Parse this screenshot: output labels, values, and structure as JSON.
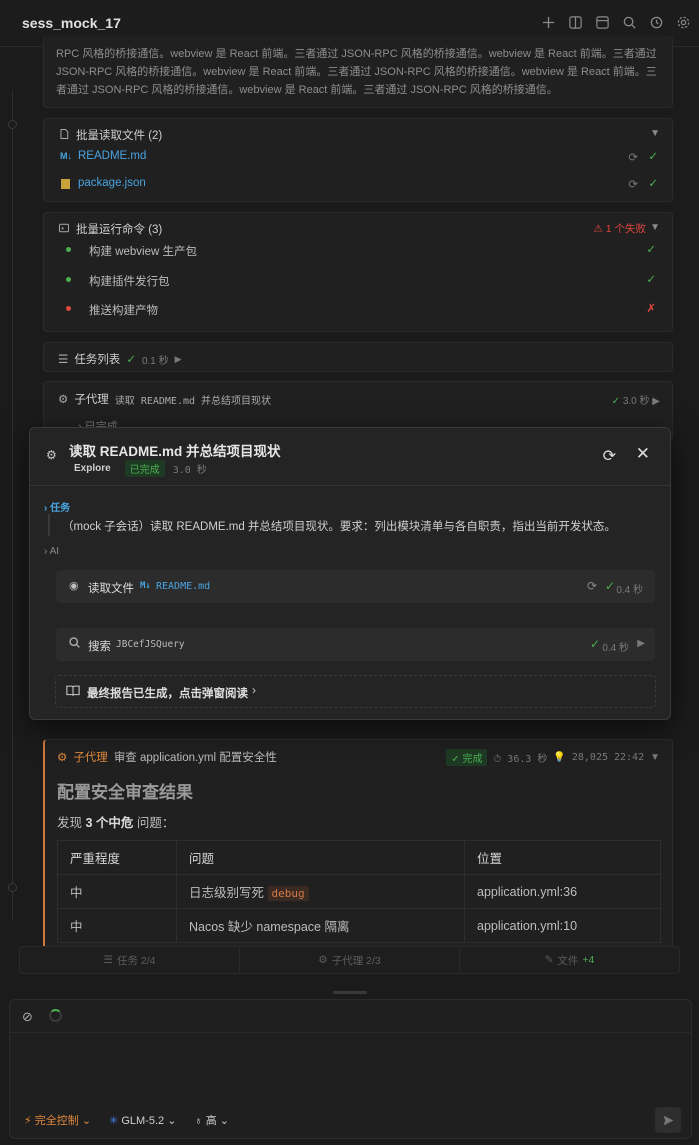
{
  "header": {
    "title": "sess_mock_17"
  },
  "intro_text": {
    "lines": [
      "RPC 风格的桥接通信。webview 是 React 前端。三者通过 JSON-RPC 风格的桥接通信。webview 是 React 前端。三者通过",
      "JSON-RPC 风格的桥接通信。webview 是 React 前端。三者通过 JSON-RPC 风格的桥接通信。webview 是 React 前端。三",
      "者通过 JSON-RPC 风格的桥接通信。webview 是 React 前端。三者通过 JSON-RPC 风格的桥接通信。"
    ]
  },
  "batch_read": {
    "title": "批量读取文件 (2)",
    "files": [
      {
        "icon": "M↓",
        "name": "README.md"
      },
      {
        "icon": "js",
        "name": "package.json"
      }
    ]
  },
  "batch_run": {
    "title": "批量运行命令 (3)",
    "fail_label": "1 个失败",
    "commands": [
      {
        "label": "构建 webview 生产包",
        "status": "ok"
      },
      {
        "label": "构建插件发行包",
        "status": "ok"
      },
      {
        "label": "推送构建产物",
        "status": "fail"
      }
    ]
  },
  "task_list": {
    "title": "任务列表",
    "time": "0.1 秒"
  },
  "subagent1": {
    "prefix": "子代理",
    "desc": "读取 README.md 并总结项目现状",
    "time": "3.0 秒",
    "done_label": "已完成"
  },
  "modal": {
    "title": "读取 README.md 并总结项目现状",
    "agent_type": "Explore",
    "status": "已完成",
    "time": "3.0 秒",
    "task_label": "任务",
    "task_text": "（mock 子会话）读取 README.md 并总结项目现状。要求：列出模块清单与各自职责，指出当前开发状态。",
    "ai_label": "AI",
    "read": {
      "label": "读取文件",
      "file": "README.md",
      "time": "0.4 秒"
    },
    "search": {
      "label": "搜索",
      "query": "JBCefJSQuery",
      "time": "0.4 秒"
    },
    "report": "最终报告已生成，点击弹窗阅读"
  },
  "subagent2": {
    "prefix": "子代理",
    "desc": "审查 application.yml 配置安全性",
    "status": "完成",
    "time": "36.3 秒",
    "tokens": "28,025",
    "clock": "22:42",
    "heading": "配置安全审查结果",
    "summary_pre": "发现",
    "summary_bold": "3 个中危",
    "summary_post": "问题：",
    "table": {
      "headers": [
        "严重程度",
        "问题",
        "位置"
      ],
      "rows": [
        {
          "level": "中",
          "issue": "日志级别写死",
          "tag": "debug",
          "loc": "application.yml:36"
        },
        {
          "level": "中",
          "issue": "Nacos 缺少 namespace 隔离",
          "tag": "",
          "loc": "application.yml:10"
        }
      ]
    }
  },
  "statusbar": {
    "tasks": "任务 2/4",
    "subagents": "子代理 2/3",
    "files": "文件",
    "files_count": "+4"
  },
  "composer": {
    "mode": "完全控制",
    "model": "GLM-5.2",
    "effort": "高"
  },
  "colors": {
    "accent_ok": "#4caf50",
    "accent_fail": "#e0463e",
    "accent_orange": "#e08a3c",
    "link_blue": "#4aa3e0"
  }
}
